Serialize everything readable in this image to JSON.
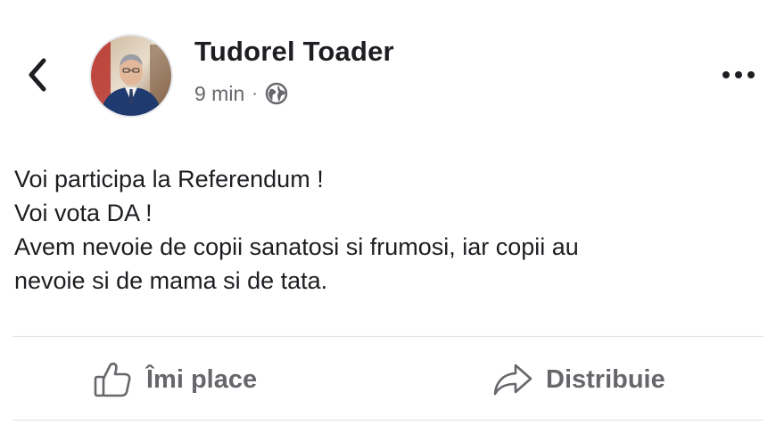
{
  "header": {
    "back_icon": "chevron-left-icon",
    "author_name": "Tudorel Toader",
    "time": "9 min",
    "separator": "·",
    "audience_icon": "globe-icon",
    "more_icon": "more-horizontal-icon"
  },
  "post": {
    "lines": [
      "Voi participa la Referendum !",
      "Voi vota DA !",
      "Avem nevoie de copii sanatosi si frumosi, iar copii au",
      "nevoie si de mama si de tata."
    ]
  },
  "actions": {
    "like_label": "Îmi place",
    "like_icon": "thumbs-up-icon",
    "share_label": "Distribuie",
    "share_icon": "share-arrow-icon"
  },
  "colors": {
    "primary_text": "#1c1e21",
    "secondary_text": "#65676b",
    "divider": "#dcdfe4"
  }
}
